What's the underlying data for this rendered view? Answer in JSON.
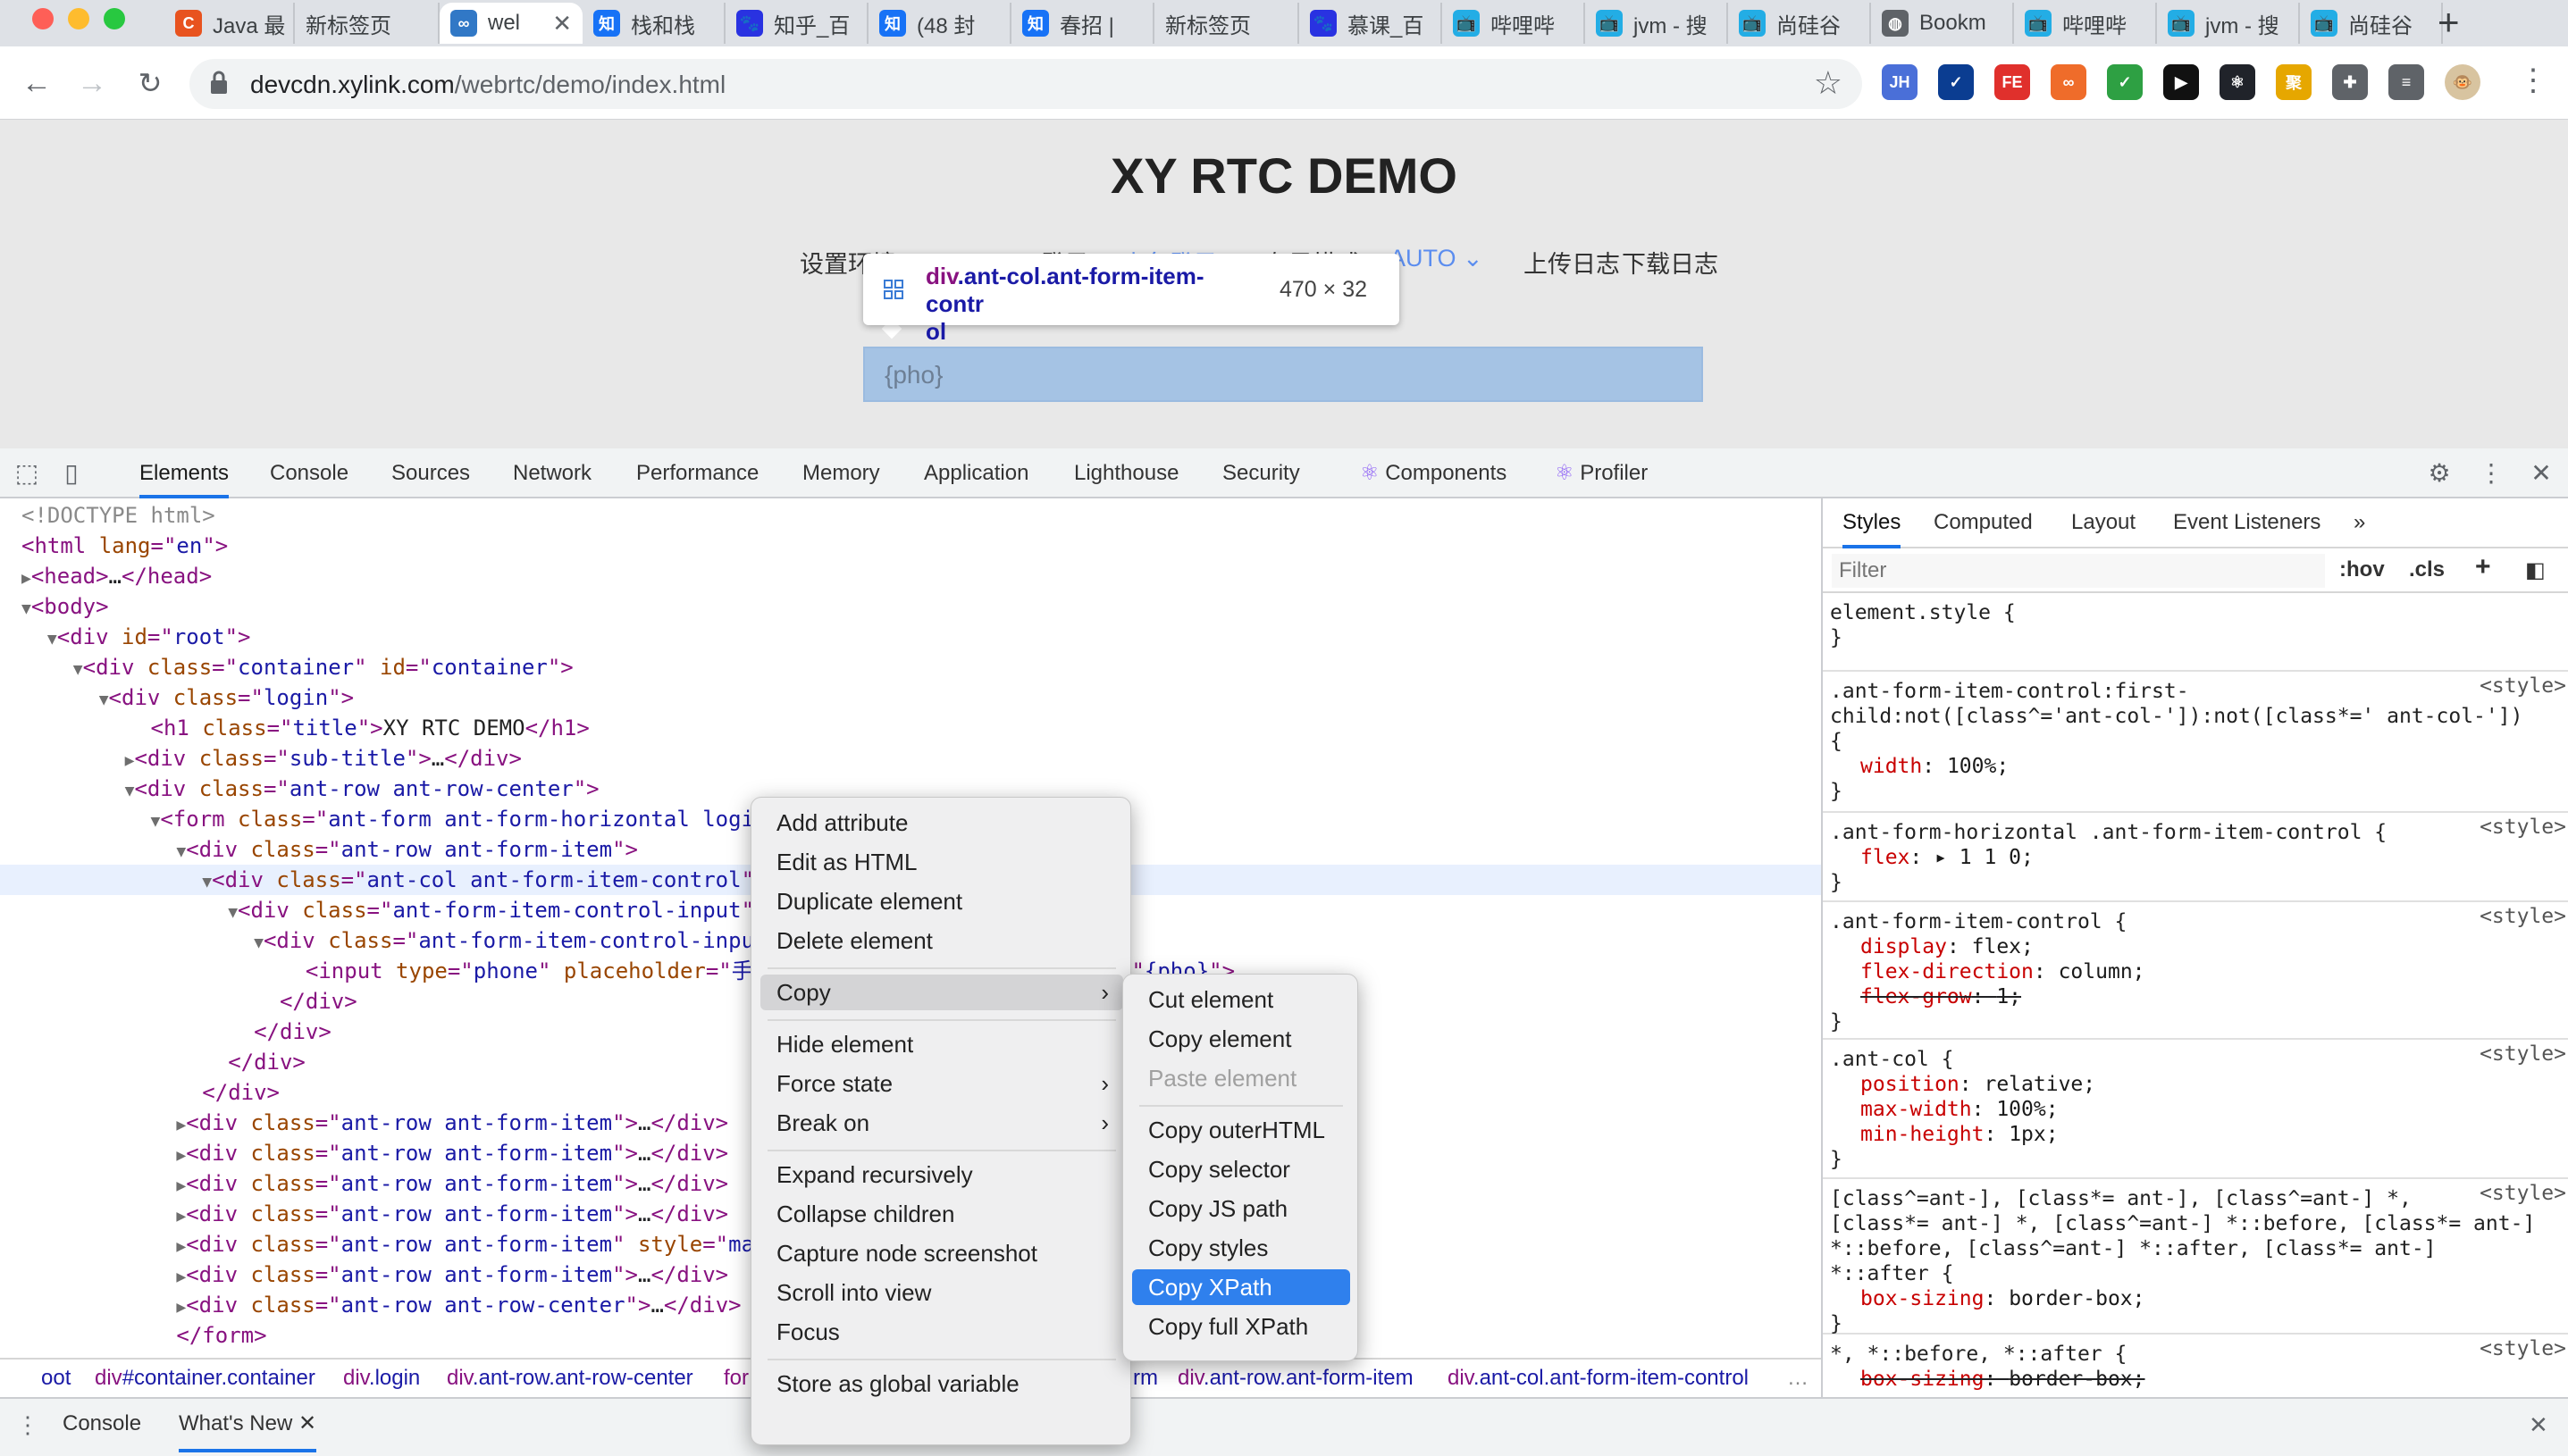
{
  "browser": {
    "tabs": [
      {
        "title": "Java 最",
        "icon": "csdn-icon",
        "color": "#e8531f",
        "glyph": "C"
      },
      {
        "title": "新标签页",
        "icon": "blank-page-icon",
        "color": "",
        "glyph": ""
      },
      {
        "title": "wel",
        "icon": "xylink-icon",
        "color": "#3178c6",
        "glyph": "∞",
        "active": true
      },
      {
        "title": "栈和栈",
        "icon": "zhihu-icon",
        "color": "#1772f6",
        "glyph": "知"
      },
      {
        "title": "知乎_百",
        "icon": "baidu-paw-icon",
        "color": "#2932e1",
        "glyph": "🐾"
      },
      {
        "title": "(48 封",
        "icon": "zhihu-icon",
        "color": "#1772f6",
        "glyph": "知"
      },
      {
        "title": "春招 |",
        "icon": "zhihu-icon",
        "color": "#1772f6",
        "glyph": "知"
      },
      {
        "title": "新标签页",
        "icon": "blank-page-icon",
        "color": "",
        "glyph": ""
      },
      {
        "title": "慕课_百",
        "icon": "baidu-paw-icon",
        "color": "#2932e1",
        "glyph": "🐾"
      },
      {
        "title": "哔哩哔",
        "icon": "bilibili-icon",
        "color": "#23ade5",
        "glyph": "📺"
      },
      {
        "title": "jvm - 搜",
        "icon": "bilibili-icon",
        "color": "#23ade5",
        "glyph": "📺"
      },
      {
        "title": "尚硅谷",
        "icon": "bilibili-icon",
        "color": "#23ade5",
        "glyph": "📺"
      },
      {
        "title": "Bookm",
        "icon": "globe-icon",
        "color": "#5f6368",
        "glyph": "◍"
      },
      {
        "title": "哔哩哔",
        "icon": "bilibili-icon",
        "color": "#23ade5",
        "glyph": "📺"
      },
      {
        "title": "jvm - 搜",
        "icon": "bilibili-icon",
        "color": "#23ade5",
        "glyph": "📺"
      },
      {
        "title": "尚硅谷",
        "icon": "bilibili-icon",
        "color": "#23ade5",
        "glyph": "📺"
      }
    ],
    "url_host": "devcdn.xylink.com",
    "url_path": "/webrtc/demo/index.html",
    "extensions": [
      {
        "name": "jh-extension-icon",
        "label": "JH",
        "color": "#4a6fd8"
      },
      {
        "name": "checkmark-extension-icon",
        "label": "✓",
        "color": "#0b3d91"
      },
      {
        "name": "fe-extension-icon",
        "label": "FE",
        "color": "#e0302c"
      },
      {
        "name": "infinity-extension-icon",
        "label": "∞",
        "color": "#ef6c2a"
      },
      {
        "name": "shield-extension-icon",
        "label": "✓",
        "color": "#2ea043"
      },
      {
        "name": "play-extension-icon",
        "label": "▶",
        "color": "#111111"
      },
      {
        "name": "react-extension-icon",
        "label": "⚛",
        "color": "#20232a"
      },
      {
        "name": "ju-extension-icon",
        "label": "聚",
        "color": "#e6a700"
      },
      {
        "name": "puzzle-extensions-icon",
        "label": "✚",
        "color": "#5f6368"
      },
      {
        "name": "media-control-icon",
        "label": "≡",
        "color": "#5f6368"
      },
      {
        "name": "profile-avatar",
        "label": "🐵",
        "color": "#d8c4a0"
      }
    ]
  },
  "page": {
    "title": "XY RTC DEMO",
    "subnav": [
      {
        "label": "设置环境",
        "color": "#333333"
      },
      {
        "label": "登录",
        "color": "#333333"
      },
      {
        "label": "小鱼登录",
        "color": "#5b8def"
      },
      {
        "label": "布局模式",
        "color": "#333333"
      },
      {
        "label": "AUTO",
        "color": "#5b8def"
      },
      {
        "label": "上传日志",
        "color": "#333333"
      },
      {
        "label": "下载日志",
        "color": "#333333"
      }
    ],
    "tooltip": {
      "tag": "div",
      "classes": ".ant-col.ant-form-item-contr",
      "classes_line2": "ol",
      "size": "470 × 32"
    },
    "input_value": "{pho}"
  },
  "devtools": {
    "tabs": [
      "Elements",
      "Console",
      "Sources",
      "Network",
      "Performance",
      "Memory",
      "Application",
      "Lighthouse",
      "Security",
      "Components",
      "Profiler"
    ],
    "active_tab": "Elements",
    "styles_tabs": [
      "Styles",
      "Computed",
      "Layout",
      "Event Listeners",
      "»"
    ],
    "filter_placeholder": "Filter",
    "hov_label": ":hov",
    "cls_label": ".cls",
    "dom_lines": [
      {
        "html": "<span class='cmt'>&lt;!DOCTYPE html&gt;</span>"
      },
      {
        "html": "<span class='tag'>&lt;html</span> <span class='attr'>lang</span><span class='tag'>=\"</span><span class='val'>en</span><span class='tag'>\"&gt;</span>"
      },
      {
        "html": "<span class='tri'>▶</span><span class='tag'>&lt;head&gt;</span>…<span class='tag'>&lt;/head&gt;</span>"
      },
      {
        "html": "<span class='tri'>▼</span><span class='tag'>&lt;body&gt;</span>"
      },
      {
        "html": "  <span class='tri'>▼</span><span class='tag'>&lt;div</span> <span class='attr'>id</span><span class='tag'>=\"</span><span class='val'>root</span><span class='tag'>\"&gt;</span>"
      },
      {
        "html": "    <span class='tri'>▼</span><span class='tag'>&lt;div</span> <span class='attr'>class</span><span class='tag'>=\"</span><span class='val'>container</span><span class='tag'>\"</span> <span class='attr'>id</span><span class='tag'>=\"</span><span class='val'>container</span><span class='tag'>\"&gt;</span>"
      },
      {
        "html": "      <span class='tri'>▼</span><span class='tag'>&lt;div</span> <span class='attr'>class</span><span class='tag'>=\"</span><span class='val'>login</span><span class='tag'>\"&gt;</span>"
      },
      {
        "html": "          <span class='tag'>&lt;h1</span> <span class='attr'>class</span><span class='tag'>=\"</span><span class='val'>title</span><span class='tag'>\"&gt;</span><span class='txt'>XY RTC DEMO</span><span class='tag'>&lt;/h1&gt;</span>"
      },
      {
        "html": "        <span class='tri'>▶</span><span class='tag'>&lt;div</span> <span class='attr'>class</span><span class='tag'>=\"</span><span class='val'>sub-title</span><span class='tag'>\"&gt;</span>…<span class='tag'>&lt;/div&gt;</span>"
      },
      {
        "html": "        <span class='tri'>▼</span><span class='tag'>&lt;div</span> <span class='attr'>class</span><span class='tag'>=\"</span><span class='val'>ant-row ant-row-center</span><span class='tag'>\"&gt;</span>"
      },
      {
        "html": "          <span class='tri'>▼</span><span class='tag'>&lt;form</span> <span class='attr'>class</span><span class='tag'>=\"</span><span class='val'>ant-form ant-form-horizontal login</span>"
      },
      {
        "html": "            <span class='tri'>▼</span><span class='tag'>&lt;div</span> <span class='attr'>class</span><span class='tag'>=\"</span><span class='val'>ant-row ant-form-item</span><span class='tag'>\"&gt;</span>"
      },
      {
        "html": "              <span class='tri'>▼</span><span class='tag'>&lt;div</span> <span class='attr'>class</span><span class='tag'>=\"</span><span class='val'>ant-col ant-form-item-control</span><span class='tag'>\"&gt;</span>",
        "selected": true
      },
      {
        "html": "                <span class='tri'>▼</span><span class='tag'>&lt;div</span> <span class='attr'>class</span><span class='tag'>=\"</span><span class='val'>ant-form-item-control-input</span><span class='tag'>\"&gt;</span>"
      },
      {
        "html": "                  <span class='tri'>▼</span><span class='tag'>&lt;div</span> <span class='attr'>class</span><span class='tag'>=\"</span><span class='val'>ant-form-item-control-input-</span>"
      },
      {
        "html": "                      <span class='tag'>&lt;input</span> <span class='attr'>type</span><span class='tag'>=\"</span><span class='val'>phone</span><span class='tag'>\"</span> <span class='attr'>placeholder</span><span class='tag'>=\"</span><span class='val'>手机号</span>                    <span class='attr'>value</span><span class='tag'>=\"</span><span class='val'>{pho}</span><span class='tag'>\"&gt;</span>"
      },
      {
        "html": "                    <span class='tag'>&lt;/div&gt;</span>"
      },
      {
        "html": "                  <span class='tag'>&lt;/div&gt;</span>"
      },
      {
        "html": "                <span class='tag'>&lt;/div&gt;</span>"
      },
      {
        "html": "              <span class='tag'>&lt;/div&gt;</span>"
      },
      {
        "html": "            <span class='tri'>▶</span><span class='tag'>&lt;div</span> <span class='attr'>class</span><span class='tag'>=\"</span><span class='val'>ant-row ant-form-item</span><span class='tag'>\"&gt;</span>…<span class='tag'>&lt;/div&gt;</span>"
      },
      {
        "html": "            <span class='tri'>▶</span><span class='tag'>&lt;div</span> <span class='attr'>class</span><span class='tag'>=\"</span><span class='val'>ant-row ant-form-item</span><span class='tag'>\"&gt;</span>…<span class='tag'>&lt;/div&gt;</span>"
      },
      {
        "html": "            <span class='tri'>▶</span><span class='tag'>&lt;div</span> <span class='attr'>class</span><span class='tag'>=\"</span><span class='val'>ant-row ant-form-item</span><span class='tag'>\"&gt;</span>…<span class='tag'>&lt;/div&gt;</span>"
      },
      {
        "html": "            <span class='tri'>▶</span><span class='tag'>&lt;div</span> <span class='attr'>class</span><span class='tag'>=\"</span><span class='val'>ant-row ant-form-item</span><span class='tag'>\"&gt;</span>…<span class='tag'>&lt;/div&gt;</span>"
      },
      {
        "html": "            <span class='tri'>▶</span><span class='tag'>&lt;div</span> <span class='attr'>class</span><span class='tag'>=\"</span><span class='val'>ant-row ant-form-item</span><span class='tag'>\"</span> <span class='attr'>style</span><span class='tag'>=\"</span><span class='val'>mar</span>"
      },
      {
        "html": "            <span class='tri'>▶</span><span class='tag'>&lt;div</span> <span class='attr'>class</span><span class='tag'>=\"</span><span class='val'>ant-row ant-form-item</span><span class='tag'>\"&gt;</span>…<span class='tag'>&lt;/div&gt;</span>"
      },
      {
        "html": "            <span class='tri'>▶</span><span class='tag'>&lt;div</span> <span class='attr'>class</span><span class='tag'>=\"</span><span class='val'>ant-row ant-row-center</span><span class='tag'>\"&gt;</span>…<span class='tag'>&lt;/div&gt;</span>"
      },
      {
        "html": "            <span class='tag'>&lt;/form&gt;</span>"
      }
    ],
    "breadcrumb": [
      {
        "tag": "",
        "cls": "oot"
      },
      {
        "tag": "div",
        "cls": "#container.container"
      },
      {
        "tag": "div",
        "cls": ".login"
      },
      {
        "tag": "div",
        "cls": ".ant-row.ant-row-center"
      },
      {
        "tag": "for",
        "cls": ""
      },
      {
        "tag": "",
        "cls": "rm"
      },
      {
        "tag": "div",
        "cls": ".ant-row.ant-form-item"
      },
      {
        "tag": "div",
        "cls": ".ant-col.ant-form-item-control"
      }
    ],
    "style_rules": [
      {
        "sel": "element.style {",
        "src": "",
        "props": [],
        "close": "}"
      },
      {
        "sel": ".ant-form-item-control:first-\nchild:not([class^='ant-col-']):not([class*=' ant-col-'])\n{",
        "src": "<style>",
        "props": [
          {
            "n": "width",
            "v": "100%;"
          }
        ],
        "close": "}"
      },
      {
        "sel": ".ant-form-horizontal .ant-form-item-control {",
        "src": "<style>",
        "props": [
          {
            "n": "flex",
            "v": "▸ 1 1 0;"
          }
        ],
        "close": "}"
      },
      {
        "sel": ".ant-form-item-control {",
        "src": "<style>",
        "props": [
          {
            "n": "display",
            "v": "flex;"
          },
          {
            "n": "flex-direction",
            "v": "column;"
          },
          {
            "n": "flex-grow",
            "v": "1;",
            "strike": true
          }
        ],
        "close": "}"
      },
      {
        "sel": ".ant-col {",
        "src": "<style>",
        "props": [
          {
            "n": "position",
            "v": "relative;"
          },
          {
            "n": "max-width",
            "v": "100%;"
          },
          {
            "n": "min-height",
            "v": "1px;"
          }
        ],
        "close": "}"
      },
      {
        "sel": "[class^=ant-], [class*= ant-], [class^=ant-] *,\n[class*= ant-] *, [class^=ant-] *::before, [class*= ant-]\n*::before, [class^=ant-] *::after, [class*= ant-]\n*::after {",
        "src": "<style>",
        "props": [
          {
            "n": "box-sizing",
            "v": "border-box;"
          }
        ],
        "close": "}"
      },
      {
        "sel": "*, *::before, *::after {",
        "src": "<style>",
        "props": [
          {
            "n": "box-sizing",
            "v": "border-box;",
            "strike": true
          }
        ],
        "close": ""
      }
    ],
    "drawer_tabs": [
      "Console",
      "What's New"
    ]
  },
  "context_menu": {
    "items": [
      {
        "label": "Add attribute"
      },
      {
        "label": "Edit as HTML"
      },
      {
        "label": "Duplicate element"
      },
      {
        "label": "Delete element"
      },
      {
        "sep": true
      },
      {
        "label": "Copy",
        "submenu": true,
        "hover": true
      },
      {
        "sep": true
      },
      {
        "label": "Hide element"
      },
      {
        "label": "Force state",
        "submenu": true
      },
      {
        "label": "Break on",
        "submenu": true
      },
      {
        "sep": true
      },
      {
        "label": "Expand recursively"
      },
      {
        "label": "Collapse children"
      },
      {
        "label": "Capture node screenshot"
      },
      {
        "label": "Scroll into view"
      },
      {
        "label": "Focus"
      },
      {
        "sep": true
      },
      {
        "label": "Store as global variable"
      }
    ]
  },
  "copy_submenu": {
    "items": [
      {
        "label": "Cut element"
      },
      {
        "label": "Copy element"
      },
      {
        "label": "Paste element",
        "disabled": true
      },
      {
        "sep": true
      },
      {
        "label": "Copy outerHTML"
      },
      {
        "label": "Copy selector"
      },
      {
        "label": "Copy JS path"
      },
      {
        "label": "Copy styles"
      },
      {
        "label": "Copy XPath",
        "active": true
      },
      {
        "label": "Copy full XPath"
      }
    ]
  }
}
